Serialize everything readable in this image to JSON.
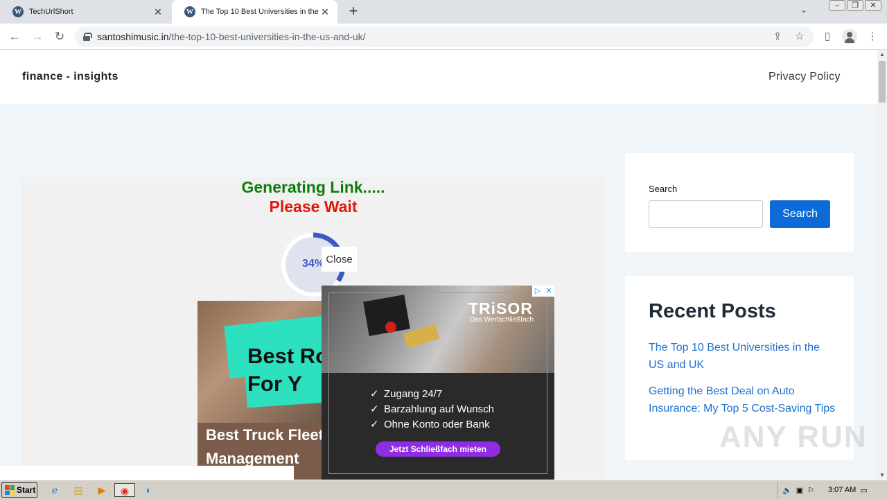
{
  "browser": {
    "tabs": [
      {
        "title": "TechUrlShort",
        "icon": "wordpress-icon"
      },
      {
        "title": "The Top 10 Best Universities in the U",
        "icon": "wordpress-icon"
      }
    ],
    "new_tab": "+",
    "url_domain": "santoshimusic.in",
    "url_path": "/the-top-10-best-universities-in-the-us-and-uk/"
  },
  "site": {
    "title": "finance - insights",
    "nav_privacy": "Privacy Policy"
  },
  "content": {
    "generating": "Generating Link.....",
    "please_wait": "Please Wait",
    "progress_label": "34%",
    "progress_fraction": 0.34,
    "close_label": "Close"
  },
  "ad_card": {
    "headline": "Best Ro\nFor Y",
    "caption": "Best Truck Fleet\nManagement"
  },
  "ad_front": {
    "brand": "TRiSOR",
    "brand_sub": "Das Wertschließfach",
    "bullets": [
      "Zugang 24/7",
      "Barzahlung auf Wunsch",
      "Ohne Konto oder Bank"
    ],
    "cta": "Jetzt Schließfach mieten",
    "badge_info": "▷",
    "badge_close": "✕"
  },
  "sidebar": {
    "search_label": "Search",
    "search_button": "Search",
    "recent_heading": "Recent Posts",
    "posts": [
      "The Top 10 Best Universities in the US and UK",
      "Getting the Best Deal on Auto Insurance: My Top 5 Cost-Saving Tips"
    ]
  },
  "watermark": "ANY RUN",
  "taskbar": {
    "start": "Start",
    "clock": "3:07 AM"
  },
  "colors": {
    "generating": "#0e7d0e",
    "please_wait": "#e3170a",
    "progress": "#3b5bc3",
    "search_button": "#0d6ad8",
    "post_link": "#1e6fcf",
    "cta": "#8e2de2"
  }
}
